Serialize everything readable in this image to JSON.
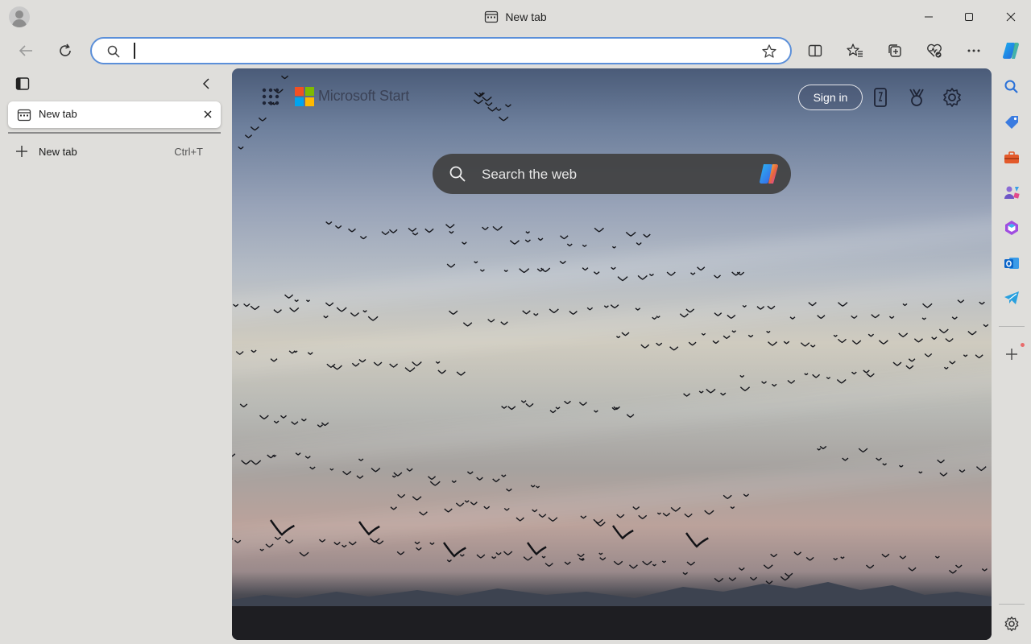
{
  "window": {
    "title": "New tab",
    "controls": {
      "minimize": "minimize-icon",
      "maximize": "maximize-icon",
      "close": "close-icon"
    }
  },
  "toolbar": {
    "address_placeholder": "",
    "address_value": "",
    "icons": [
      "back-icon",
      "refresh-icon",
      "search-icon",
      "favorite-star-icon",
      "split-screen-icon",
      "favorites-icon",
      "collections-icon",
      "browser-essentials-icon",
      "more-icon",
      "copilot-icon"
    ]
  },
  "tab_pane": {
    "tabs": [
      {
        "label": "New tab",
        "active": true
      }
    ],
    "new_tab": {
      "label": "New tab",
      "shortcut": "Ctrl+T"
    }
  },
  "start_page": {
    "brand": "Microsoft Start",
    "sign_in_label": "Sign in",
    "search_placeholder": "Search the web",
    "brand_colors": [
      "#f25022",
      "#7fba00",
      "#00a4ef",
      "#ffb900"
    ]
  },
  "sidebar": {
    "items": [
      "search-icon",
      "shopping-tag-icon",
      "tools-icon",
      "games-icon",
      "microsoft-365-icon",
      "outlook-icon",
      "telegram-drop-icon",
      "add-icon",
      "settings-icon"
    ]
  },
  "colors": {
    "accent": "#5b8fd9",
    "chrome": "#dfdedb"
  }
}
